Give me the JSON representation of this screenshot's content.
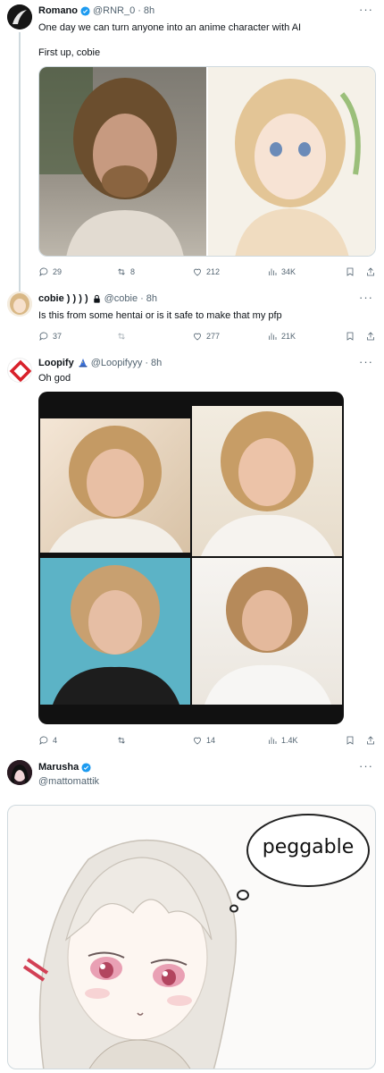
{
  "tweets": [
    {
      "name": "Romano",
      "handle": "@RNR_0",
      "sep": "·",
      "time": "8h",
      "text_line1": "One day we can turn anyone into an anime character with AI",
      "text_line2": "First up, cobie",
      "replies": "29",
      "retweets": "8",
      "likes": "212",
      "views": "34K"
    },
    {
      "name": "cobie ) ) ) )",
      "handle": "@cobie",
      "sep": "·",
      "time": "8h",
      "text": "Is this from some hentai or is it safe to make that my pfp",
      "replies": "37",
      "retweets": "",
      "likes": "277",
      "views": "21K"
    },
    {
      "name": "Loopify",
      "handle": "@Loopifyyy",
      "sep": "·",
      "time": "8h",
      "text": "Oh god",
      "replies": "4",
      "retweets": "",
      "likes": "14",
      "views": "1.4K"
    },
    {
      "name": "Marusha",
      "handle": "@mattomattik",
      "bubble_text": "peggable"
    }
  ],
  "colors": {
    "verified": "#1d9bf0",
    "text": "#0f1419",
    "muted": "#536471",
    "border": "#cfd9de"
  },
  "icons": [
    "verified-badge-icon",
    "lock-icon",
    "reply-icon",
    "retweet-icon",
    "like-icon",
    "views-icon",
    "bookmark-icon",
    "share-icon",
    "more-icon"
  ]
}
